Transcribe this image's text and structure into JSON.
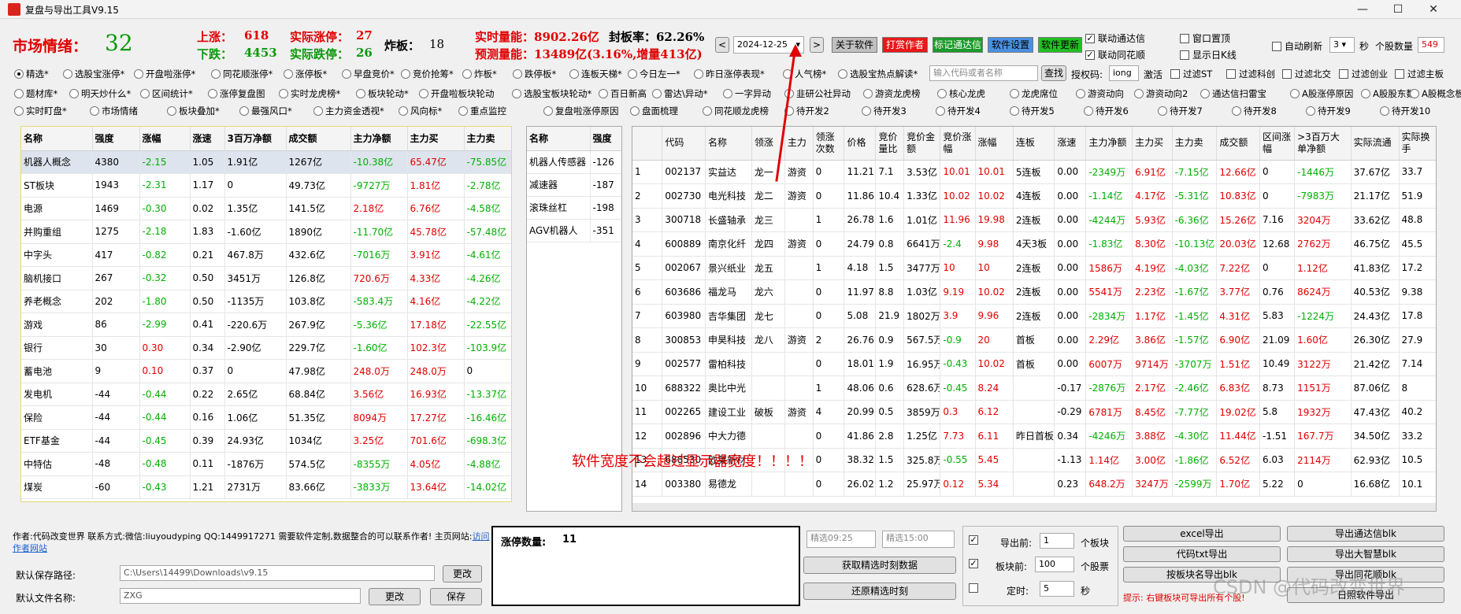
{
  "app": {
    "title": "复盘与导出工具V9.15",
    "min": "—",
    "max": "☐",
    "close": "✕"
  },
  "sentiment": {
    "label": "市场情绪：",
    "value": "32"
  },
  "stats": {
    "up_label": "上涨：",
    "up": "618",
    "down_label": "下跌：",
    "down": "4453",
    "real_up_label": "实际涨停：",
    "real_up": "27",
    "real_down_label": "实际跌停：",
    "real_down": "26",
    "boom_label": "炸板：",
    "boom": "18",
    "volume": "实时量能：8902.26亿",
    "seal_rate": "封板率：62.26%",
    "forecast": "预测量能：13489亿(3.16%,增量413亿)"
  },
  "date": {
    "value": "2024-12-25",
    "prev": "<",
    "next": ">"
  },
  "colorbuttons": [
    {
      "label": "关于软件",
      "bg": "#c0c0c0",
      "fg": "#000000"
    },
    {
      "label": "打赏作者",
      "bg": "#e81818",
      "fg": "#ffffff"
    },
    {
      "label": "标记通达信",
      "bg": "#1a9a2a",
      "fg": "#ffffff"
    },
    {
      "label": "软件设置",
      "bg": "#4a90e2",
      "fg": "#000000"
    },
    {
      "label": "软件更新",
      "bg": "#22c022",
      "fg": "#000000"
    }
  ],
  "opts": {
    "link_tdx": "联动通达信",
    "link_ths": "联动同花顺",
    "pin": "窗口置顶",
    "daily": "显示日K线",
    "autorefresh": "自动刷新",
    "interval": "3",
    "sec": "秒",
    "stock_count_label": "个股数量",
    "stock_count": "549"
  },
  "radios1": [
    "精选*",
    "选股宝涨停*",
    "开盘啦涨停*",
    "同花顺涨停*",
    "涨停板*",
    "早盘竞价*",
    "竞价抢筹*",
    "炸板*",
    "跌停板*",
    "连板天梯*",
    "今日左一*",
    "昨日涨停表现*",
    "人气榜*",
    "选股宝热点解读*"
  ],
  "search": {
    "placeholder": "输入代码或者名称",
    "btn": "查找",
    "auth_label": "授权码:",
    "auth": "iong",
    "activate": "激活"
  },
  "filters": [
    "过滤ST",
    "过滤科创",
    "过滤北交",
    "过滤创业",
    "过滤主板"
  ],
  "radios2": [
    "题材库*",
    "明天炒什么*",
    "区间统计*",
    "涨停复盘图",
    "实时龙虎榜*",
    "板块轮动*",
    "开盘啦板块轮动",
    "选股宝板块轮动*",
    "百日新高",
    "雷达\\异动*",
    "一字异动",
    "韭研公社异动",
    "游资龙虎榜",
    "核心龙虎",
    "龙虎席位",
    "游资动向",
    "游资动向2",
    "通达信扫雷宝",
    "A股涨停原因",
    "A股股东数",
    "A股概念板"
  ],
  "radios3": [
    "实时盯盘*",
    "市场情绪",
    "板块叠加*",
    "最强风口*",
    "主力资金透视*",
    "风向标*",
    "重点监控",
    "复盘啦涨停原因",
    "盘面梳理",
    "同花顺龙虎榜",
    "待开发2",
    "待开发3",
    "待开发4",
    "待开发5",
    "待开发6",
    "待开发7",
    "待开发8",
    "待开发9",
    "待开发10"
  ],
  "sector": {
    "headers": [
      "名称",
      "强度",
      "涨幅",
      "涨速",
      "3百万净额",
      "成交额",
      "主力净额",
      "主力买",
      "主力卖"
    ],
    "rows": [
      [
        "机器人概念",
        "4380",
        "-2.15",
        "1.05",
        "1.91亿",
        "1267亿",
        "-10.38亿",
        "65.47亿",
        "-75.85亿"
      ],
      [
        "ST板块",
        "1943",
        "-2.31",
        "1.17",
        "0",
        "49.73亿",
        "-9727万",
        "1.81亿",
        "-2.78亿"
      ],
      [
        "电源",
        "1469",
        "-0.30",
        "0.02",
        "1.35亿",
        "141.5亿",
        "2.18亿",
        "6.76亿",
        "-4.58亿"
      ],
      [
        "并购重组",
        "1275",
        "-2.18",
        "1.83",
        "-1.60亿",
        "1890亿",
        "-11.70亿",
        "45.78亿",
        "-57.48亿"
      ],
      [
        "中字头",
        "417",
        "-0.82",
        "0.21",
        "467.8万",
        "432.6亿",
        "-7016万",
        "3.91亿",
        "-4.61亿"
      ],
      [
        "脑机接口",
        "267",
        "-0.32",
        "0.50",
        "3451万",
        "126.8亿",
        "720.6万",
        "4.33亿",
        "-4.26亿"
      ],
      [
        "养老概念",
        "202",
        "-1.80",
        "0.50",
        "-1135万",
        "103.8亿",
        "-583.4万",
        "4.16亿",
        "-4.22亿"
      ],
      [
        "游戏",
        "86",
        "-2.99",
        "0.41",
        "-220.6万",
        "267.9亿",
        "-5.36亿",
        "17.18亿",
        "-22.55亿"
      ],
      [
        "银行",
        "30",
        "0.30",
        "0.34",
        "-2.90亿",
        "229.7亿",
        "-1.60亿",
        "102.3亿",
        "-103.9亿"
      ],
      [
        "蓄电池",
        "9",
        "0.10",
        "0.37",
        "0",
        "47.98亿",
        "248.0万",
        "248.0万",
        "0"
      ],
      [
        "发电机",
        "-44",
        "-0.44",
        "0.22",
        "2.65亿",
        "68.84亿",
        "3.56亿",
        "16.93亿",
        "-13.37亿"
      ],
      [
        "保险",
        "-44",
        "-0.44",
        "0.16",
        "1.06亿",
        "51.35亿",
        "8094万",
        "17.27亿",
        "-16.46亿"
      ],
      [
        "ETF基金",
        "-44",
        "-0.45",
        "0.39",
        "24.93亿",
        "1034亿",
        "3.25亿",
        "701.6亿",
        "-698.3亿"
      ],
      [
        "中特估",
        "-48",
        "-0.48",
        "0.11",
        "-1876万",
        "574.5亿",
        "-8355万",
        "4.05亿",
        "-4.88亿"
      ],
      [
        "煤炭",
        "-60",
        "-0.43",
        "1.21",
        "2731万",
        "83.66亿",
        "-3833万",
        "13.64亿",
        "-14.02亿"
      ]
    ]
  },
  "sub": {
    "headers": [
      "名称",
      "强度"
    ],
    "rows": [
      [
        "机器人传感器",
        "-126"
      ],
      [
        "减速器",
        "-187"
      ],
      [
        "滚珠丝杠",
        "-198"
      ],
      [
        "AGV机器人",
        "-351"
      ]
    ]
  },
  "stocks": {
    "headers": [
      "",
      "代码",
      "名称",
      "领涨",
      "主力",
      "领涨次数",
      "价格",
      "竞价量比",
      "竞价金额",
      "竞价涨幅",
      "涨幅",
      "连板",
      "涨速",
      "主力净额",
      "主力买",
      "主力卖",
      "成交额",
      "区间涨幅",
      ">3百万大单净额",
      "实际流通",
      "实际换手"
    ],
    "rows": [
      [
        "1",
        "002137",
        "实益达",
        "龙一",
        "游资",
        "0",
        "11.21",
        "7.1",
        "3.53亿",
        "10.01",
        "10.01",
        "5连板",
        "0.00",
        "-2349万",
        "6.91亿",
        "-7.15亿",
        "12.66亿",
        "0",
        "-1446万",
        "37.67亿",
        "33.7"
      ],
      [
        "2",
        "002730",
        "电光科技",
        "龙二",
        "游资",
        "0",
        "11.86",
        "10.4",
        "1.33亿",
        "10.02",
        "10.02",
        "4连板",
        "0.00",
        "-1.14亿",
        "4.17亿",
        "-5.31亿",
        "10.83亿",
        "0",
        "-7983万",
        "21.17亿",
        "51.9"
      ],
      [
        "3",
        "300718",
        "长盛轴承",
        "龙三",
        "",
        "1",
        "26.78",
        "1.6",
        "1.01亿",
        "11.96",
        "19.98",
        "2连板",
        "0.00",
        "-4244万",
        "5.93亿",
        "-6.36亿",
        "15.26亿",
        "7.16",
        "3204万",
        "33.62亿",
        "48.8"
      ],
      [
        "4",
        "600889",
        "南京化纤",
        "龙四",
        "游资",
        "0",
        "24.79",
        "0.8",
        "6641万",
        "-2.4",
        "9.98",
        "4天3板",
        "0.00",
        "-1.83亿",
        "8.30亿",
        "-10.13亿",
        "20.03亿",
        "12.68",
        "2762万",
        "46.75亿",
        "45.5"
      ],
      [
        "5",
        "002067",
        "景兴纸业",
        "龙五",
        "",
        "1",
        "4.18",
        "1.5",
        "3477万",
        "10",
        "10",
        "2连板",
        "0.00",
        "1586万",
        "4.19亿",
        "-4.03亿",
        "7.22亿",
        "0",
        "1.12亿",
        "41.83亿",
        "17.2"
      ],
      [
        "6",
        "603686",
        "福龙马",
        "龙六",
        "",
        "0",
        "11.97",
        "8.8",
        "1.03亿",
        "9.19",
        "10.02",
        "2连板",
        "0.00",
        "5541万",
        "2.23亿",
        "-1.67亿",
        "3.77亿",
        "0.76",
        "8624万",
        "40.53亿",
        "9.38"
      ],
      [
        "7",
        "603980",
        "吉华集团",
        "龙七",
        "",
        "0",
        "5.08",
        "21.9",
        "1802万",
        "3.9",
        "9.96",
        "2连板",
        "0.00",
        "-2834万",
        "1.17亿",
        "-1.45亿",
        "4.31亿",
        "5.83",
        "-1224万",
        "24.43亿",
        "17.8"
      ],
      [
        "8",
        "300853",
        "申昊科技",
        "龙八",
        "游资",
        "2",
        "26.76",
        "0.9",
        "567.5万",
        "-0.9",
        "20",
        "首板",
        "0.00",
        "2.29亿",
        "3.86亿",
        "-1.57亿",
        "6.90亿",
        "21.09",
        "1.60亿",
        "26.30亿",
        "27.9"
      ],
      [
        "9",
        "002577",
        "雷柏科技",
        "",
        "",
        "0",
        "18.01",
        "1.9",
        "16.95万",
        "-0.43",
        "10.02",
        "首板",
        "0.00",
        "6007万",
        "9714万",
        "-3707万",
        "1.51亿",
        "10.49",
        "3122万",
        "21.42亿",
        "7.14"
      ],
      [
        "10",
        "688322",
        "奥比中光",
        "",
        "",
        "1",
        "48.06",
        "0.6",
        "628.6万",
        "-0.45",
        "8.24",
        "",
        "-0.17",
        "-2876万",
        "2.17亿",
        "-2.46亿",
        "6.83亿",
        "8.73",
        "1151万",
        "87.06亿",
        "8"
      ],
      [
        "11",
        "002265",
        "建设工业",
        "破板",
        "游资",
        "4",
        "20.99",
        "0.5",
        "3859万",
        "0.3",
        "6.12",
        "",
        "-0.29",
        "6781万",
        "8.45亿",
        "-7.77亿",
        "19.02亿",
        "5.8",
        "1932万",
        "47.43亿",
        "40.2"
      ],
      [
        "12",
        "002896",
        "中大力德",
        "",
        "",
        "0",
        "41.86",
        "2.8",
        "1.25亿",
        "7.73",
        "6.11",
        "昨日首板",
        "0.34",
        "-4246万",
        "3.88亿",
        "-4.30亿",
        "11.44亿",
        "-1.51",
        "167.7万",
        "34.50亿",
        "33.2"
      ],
      [
        "13",
        "688530",
        "欧莱新材",
        "",
        "",
        "0",
        "38.32",
        "1.5",
        "325.8万",
        "-0.55",
        "5.45",
        "",
        "-1.13",
        "1.14亿",
        "3.00亿",
        "-1.86亿",
        "6.52亿",
        "6.03",
        "2114万",
        "62.93亿",
        "10.5"
      ],
      [
        "14",
        "003380",
        "易德龙",
        "",
        "",
        "0",
        "26.02",
        "1.2",
        "25.97万",
        "0.12",
        "5.34",
        "",
        "0.23",
        "648.2万",
        "3247万",
        "-2599万",
        "1.70亿",
        "5.22",
        "0",
        "16.68亿",
        "10.1"
      ]
    ]
  },
  "annotation": "软件宽度不会超过显示器宽度！！！！",
  "footer": {
    "author": "作者:代码改变世界 联系方式:微信:liuyoudyping QQ:1449917271 需要软件定制,数据整合的可以联系作者! 主页网站:",
    "site": "访问作者网站",
    "save_path_label": "默认保存路径:",
    "save_path": "C:\\Users\\14499\\Downloads\\v9.15",
    "change": "更改",
    "file_label": "默认文件名称:",
    "file_name": "ZXG",
    "change2": "更改",
    "save": "保存",
    "limit_label": "涨停数量:",
    "limit_count": "11",
    "time1": "精选09:25",
    "time2": "精选15:00",
    "fetch": "获取精选时刻数据",
    "restore": "还原精选时刻",
    "export_before": "导出前:",
    "export_n": "1",
    "unit_block": "个板块",
    "block_before": "板块前:",
    "block_n": "100",
    "unit_stock": "个股票",
    "timer": "定时:",
    "timer_n": "5",
    "sec": "秒",
    "excel": "excel导出",
    "tdx_blk": "导出通达信blk",
    "txt": "代码txt导出",
    "dzh_blk": "导出大智慧blk",
    "sector_blk": "按板块名导出blk",
    "ths_blk": "导出同花顺blk",
    "daily_ss": "日照软件导出",
    "tip": "提示: 右键板块可导出所有个股!",
    "watermark": "CSDN @代码改变世界"
  }
}
